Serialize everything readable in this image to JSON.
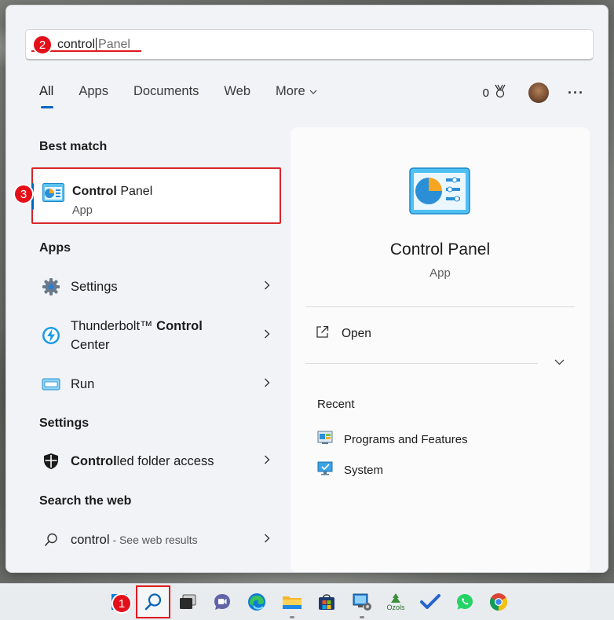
{
  "search": {
    "typed": "control",
    "suggestion": "Panel"
  },
  "annotations": {
    "step1": "1",
    "step2": "2",
    "step3": "3"
  },
  "tabs": [
    {
      "label": "All",
      "active": true
    },
    {
      "label": "Apps"
    },
    {
      "label": "Documents"
    },
    {
      "label": "Web"
    },
    {
      "label": "More"
    }
  ],
  "header": {
    "points": "0"
  },
  "best_match": {
    "section_title": "Best match",
    "name_bold": "Control",
    "name_rest": " Panel",
    "type": "App"
  },
  "apps": {
    "section_title": "Apps",
    "items": [
      {
        "pre": "Settings",
        "bold": "",
        "post": ""
      },
      {
        "pre": "Thunderbolt™ ",
        "bold": "Control",
        "post": " Center"
      },
      {
        "pre": "Run",
        "bold": "",
        "post": ""
      }
    ]
  },
  "settings": {
    "section_title": "Settings",
    "items": [
      {
        "bold": "Control",
        "post": "led folder access"
      }
    ]
  },
  "web": {
    "section_title": "Search the web",
    "query": "control",
    "hint": " - See web results"
  },
  "preview": {
    "name": "Control Panel",
    "type": "App",
    "actions": [
      {
        "label": "Open"
      }
    ],
    "recent_title": "Recent",
    "recent": [
      {
        "label": "Programs and Features"
      },
      {
        "label": "System"
      }
    ]
  },
  "taskbar": {
    "ozols_label": "Ozols"
  },
  "colors": {
    "accent": "#0067c0",
    "annotation_red": "#e3101a",
    "panel_bg": "#f1f3f6"
  }
}
